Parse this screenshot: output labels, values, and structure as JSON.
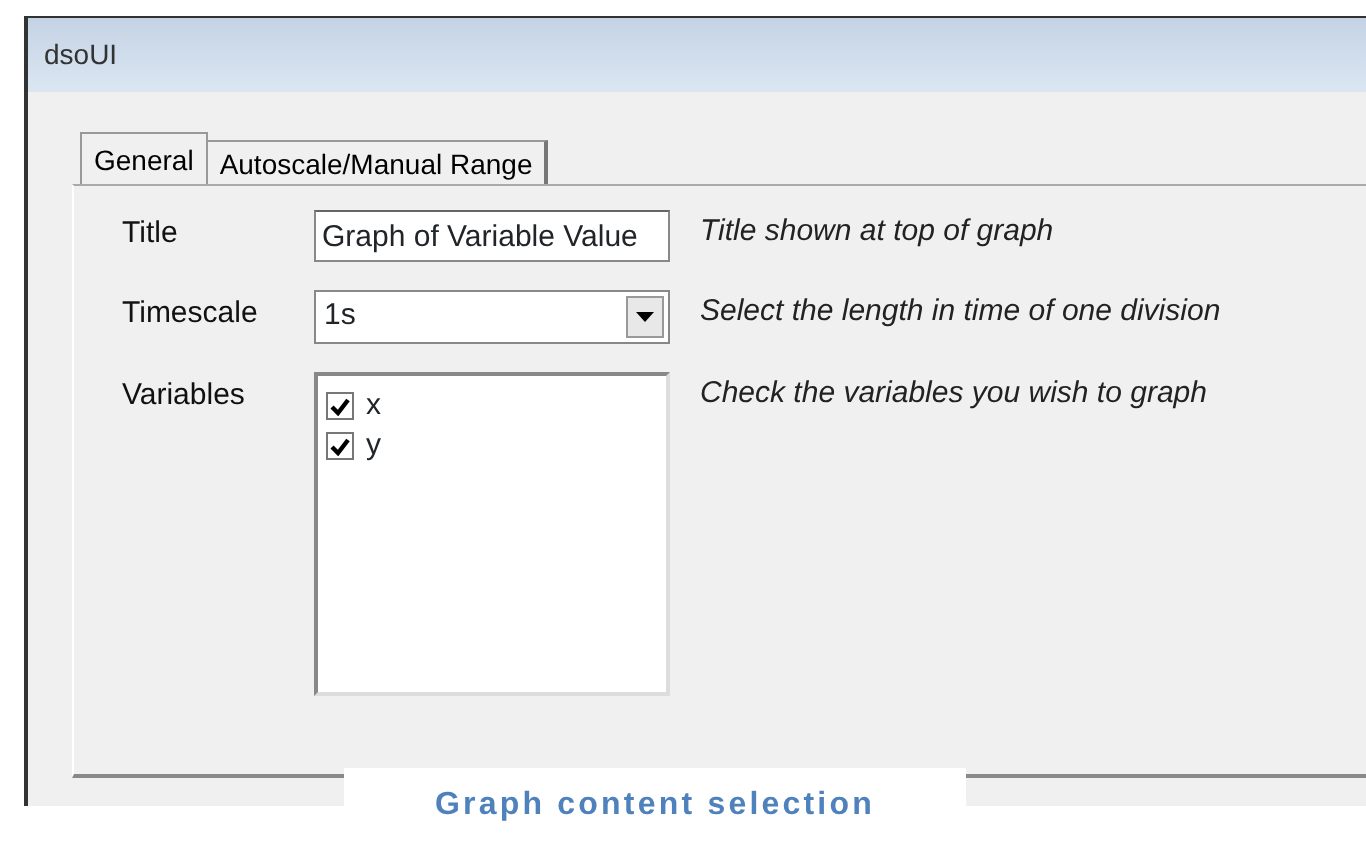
{
  "window": {
    "title": "dsoUI"
  },
  "tabs": [
    {
      "label": "General",
      "selected": true
    },
    {
      "label": "Autoscale/Manual Range",
      "selected": false
    }
  ],
  "fields": [
    {
      "kind": "text",
      "label": "Title",
      "value": "Graph of Variable Value",
      "hint": "Title shown at top of graph"
    },
    {
      "kind": "combo",
      "label": "Timescale",
      "value": "1s",
      "hint": "Select the length in time of one division"
    },
    {
      "kind": "checklist",
      "label": "Variables",
      "items": [
        {
          "label": "x",
          "checked": true
        },
        {
          "label": "y",
          "checked": true
        }
      ],
      "hint": "Check the variables you wish to graph"
    }
  ],
  "caption": "Graph content selection"
}
